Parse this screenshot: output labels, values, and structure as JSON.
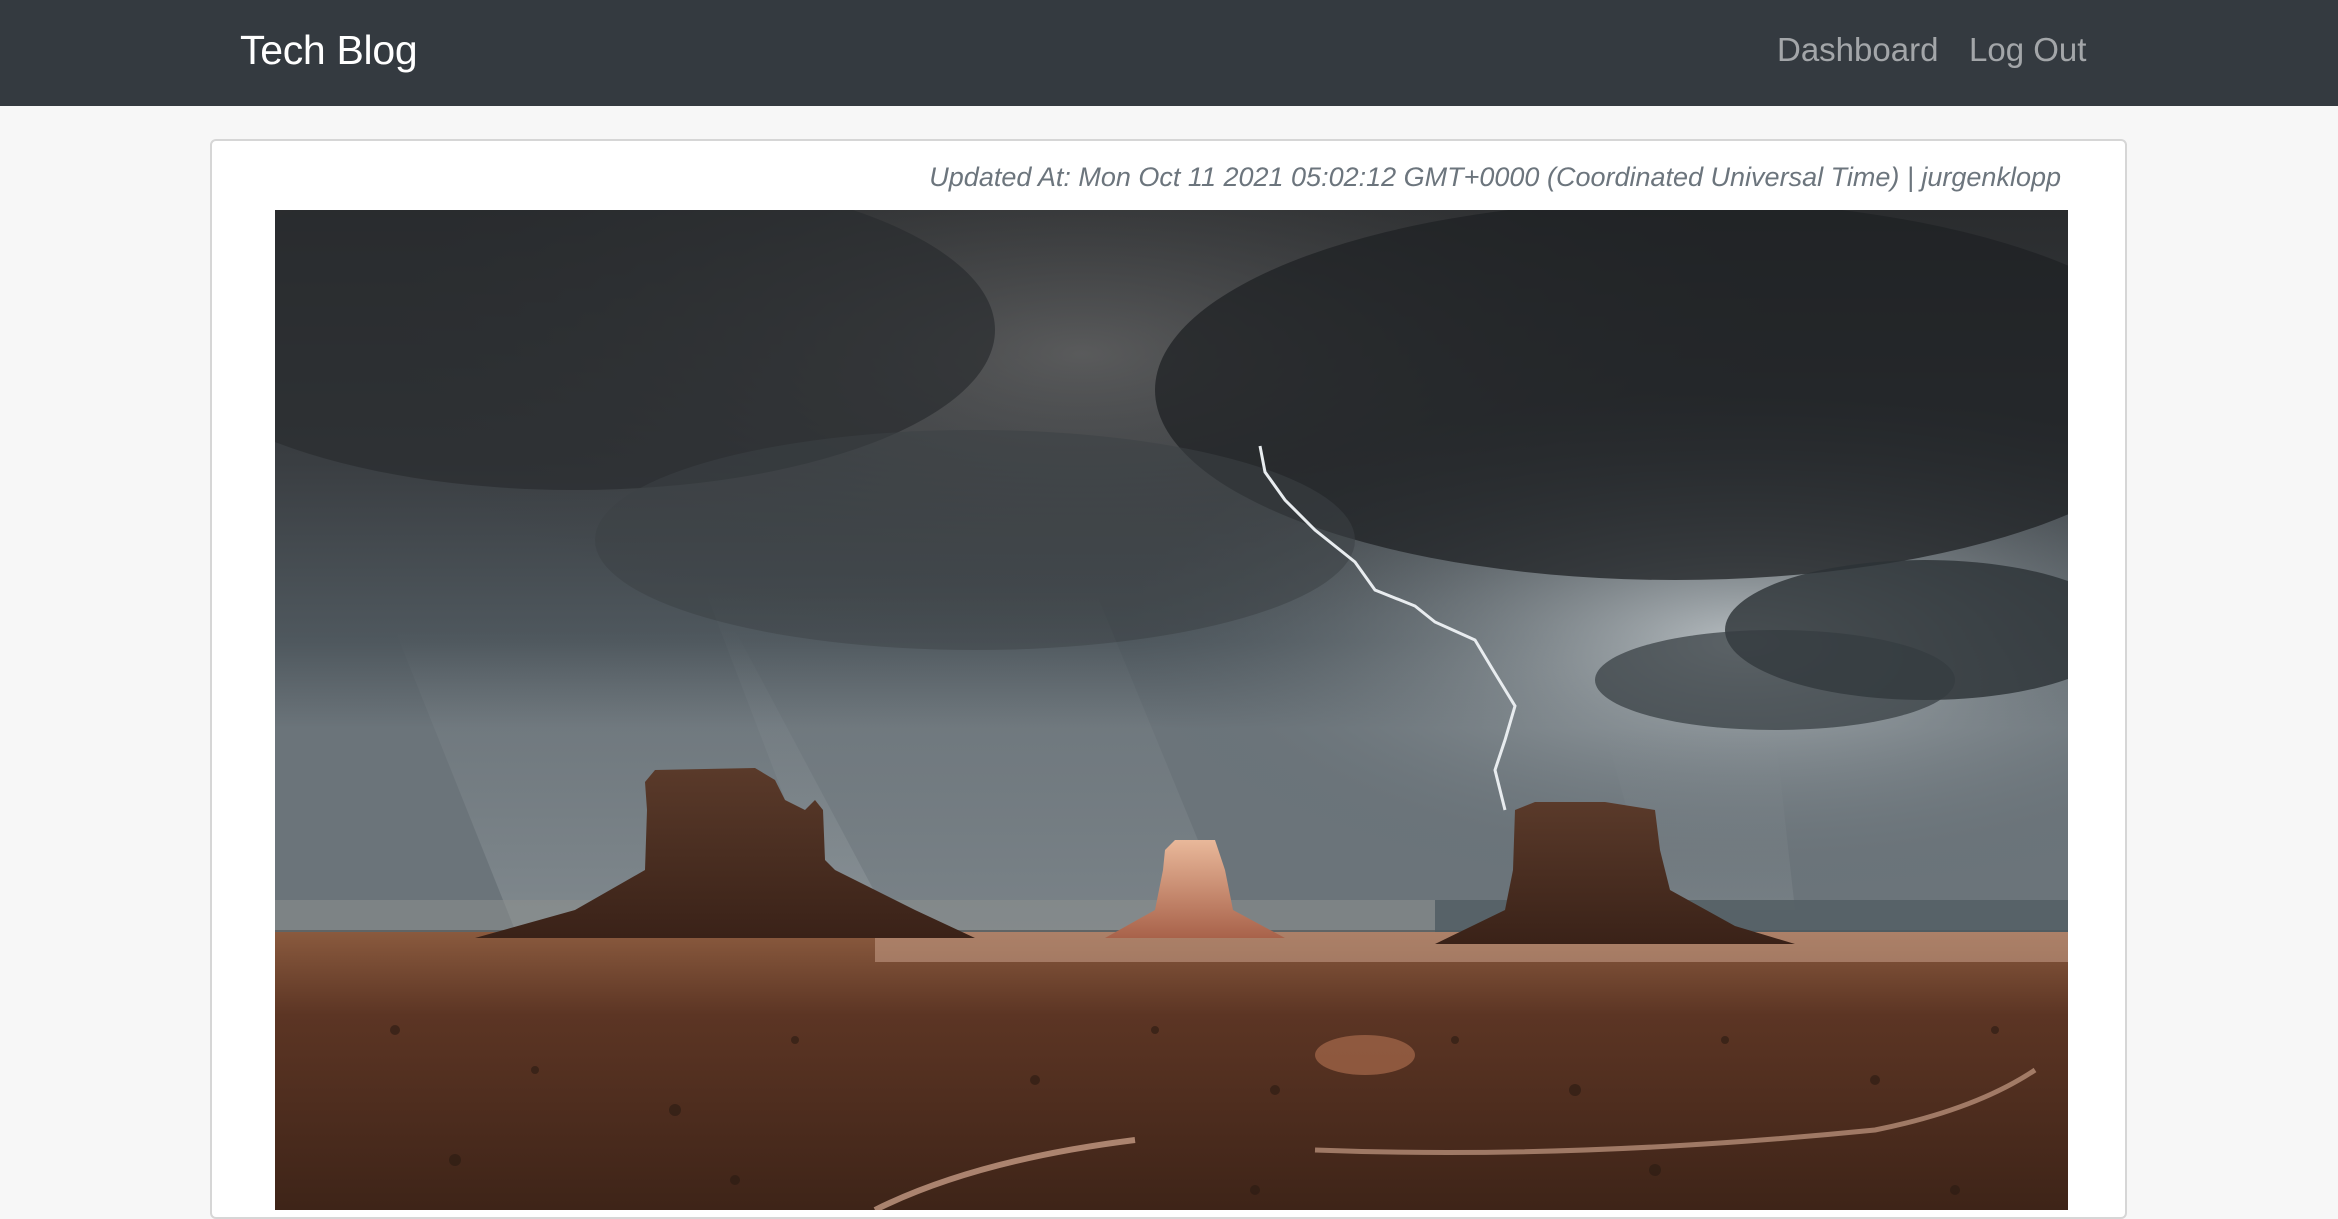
{
  "navbar": {
    "brand": "Tech Blog",
    "links": [
      {
        "label": "Dashboard"
      },
      {
        "label": "Log Out"
      }
    ]
  },
  "post": {
    "updated_prefix": "Updated At:",
    "updated_at": "Mon Oct 11 2021 05:02:12 GMT+0000 (Coordinated Universal Time)",
    "separator": "|",
    "author": "jurgenklopp"
  },
  "colors": {
    "navbar_bg": "#343a40",
    "page_bg": "#f7f7f7",
    "muted_text": "#6c757d"
  }
}
